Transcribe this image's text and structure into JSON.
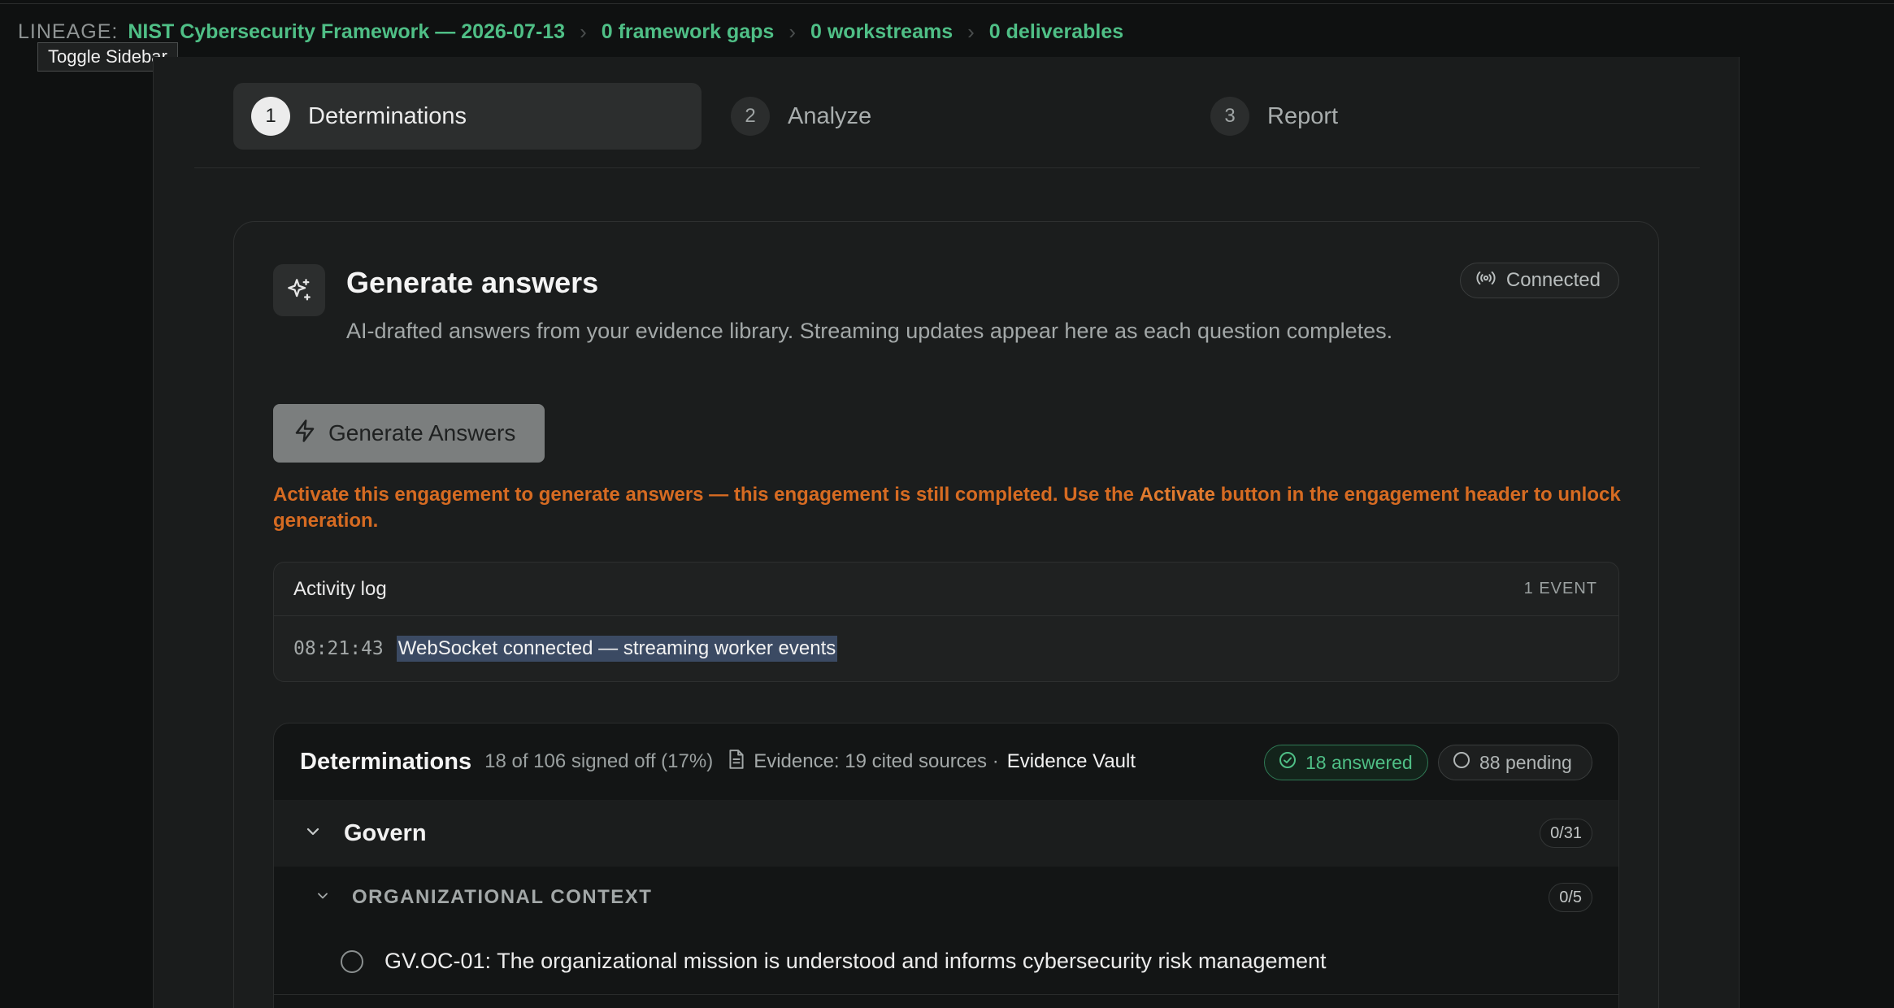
{
  "lineage": {
    "label": "LINEAGE:",
    "framework": "NIST Cybersecurity Framework — 2026-07-13",
    "gaps": "0 framework gaps",
    "workstreams": "0 workstreams",
    "deliverables": "0 deliverables"
  },
  "tooltip": "Toggle Sidebar",
  "steps": [
    {
      "num": "1",
      "label": "Determinations",
      "active": true
    },
    {
      "num": "2",
      "label": "Analyze",
      "active": false
    },
    {
      "num": "3",
      "label": "Report",
      "active": false
    }
  ],
  "generate": {
    "title": "Generate answers",
    "description": "AI-drafted answers from your evidence library. Streaming updates appear here as each question completes.",
    "status": "Connected",
    "button_label": "Generate Answers",
    "warning_pre": "Activate this engagement to generate answers — this engagement is still completed. Use the ",
    "warning_bold": "Activate",
    "warning_post": " button in the engagement header to unlock generation."
  },
  "activity_log": {
    "title": "Activity log",
    "count": "1 EVENT",
    "events": [
      {
        "time": "08:21:43",
        "message": "WebSocket connected — streaming worker events"
      }
    ]
  },
  "determinations": {
    "title": "Determinations",
    "signed_off": "18 of 106 signed off (17%)",
    "evidence": "Evidence: 19 cited sources ·",
    "vault": "Evidence Vault",
    "answered": "18 answered",
    "pending": "88 pending",
    "group": {
      "name": "Govern",
      "count": "0/31"
    },
    "category": {
      "name": "ORGANIZATIONAL CONTEXT",
      "count": "0/5"
    },
    "items": [
      {
        "label": "GV.OC-01: The organizational mission is understood and informs cybersecurity risk management"
      }
    ]
  },
  "colors": {
    "accent_green": "#4fbf86",
    "warning_orange": "#d66b22",
    "highlight": "#3b4a63"
  }
}
